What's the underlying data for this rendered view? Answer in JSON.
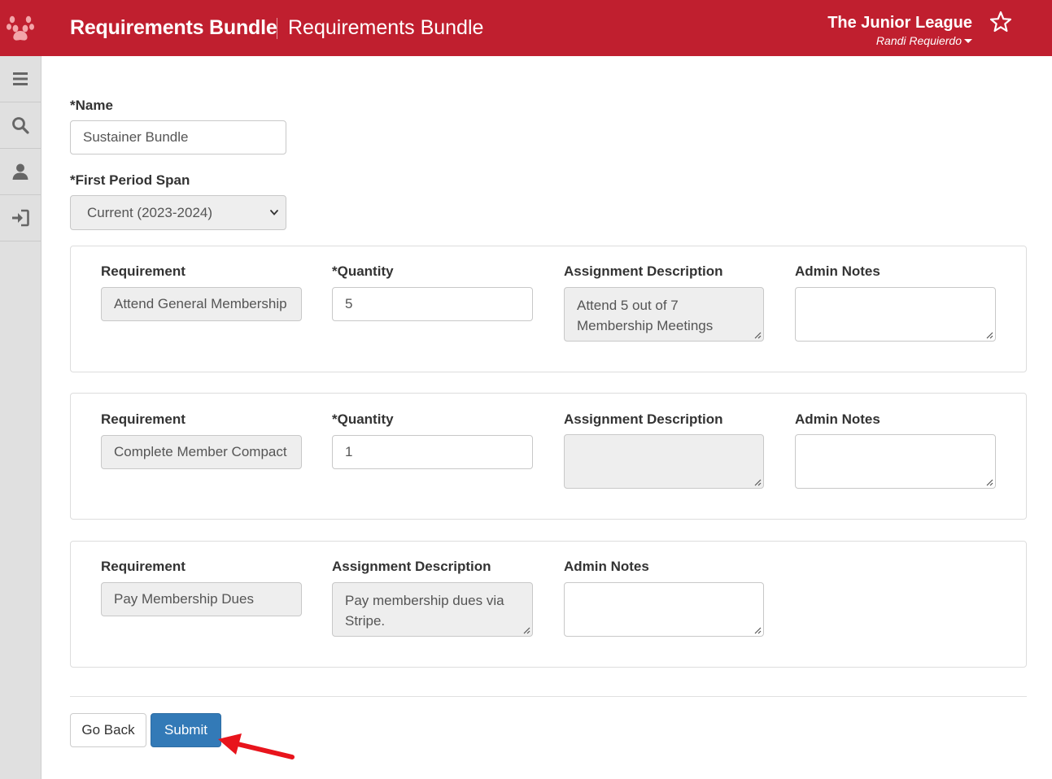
{
  "header": {
    "title": "Requirements Bundle",
    "subtitle": "Requirements Bundle",
    "organization": "The Junior League",
    "user_name": "Randi Requierdo"
  },
  "sidebar": {
    "items": [
      {
        "icon": "menu-icon"
      },
      {
        "icon": "search-icon"
      },
      {
        "icon": "user-icon"
      },
      {
        "icon": "sign-in-icon"
      }
    ]
  },
  "form": {
    "name_label": "*Name",
    "name_value": "Sustainer Bundle",
    "period_label": "*First Period Span",
    "period_value": "Current (2023-2024)"
  },
  "requirements": [
    {
      "requirement_label": "Requirement",
      "requirement_value": "Attend General Membership",
      "quantity_label": "*Quantity",
      "quantity_value": "5",
      "description_label": "Assignment Description",
      "description_value": "Attend 5 out of 7 Membership Meetings",
      "notes_label": "Admin Notes",
      "notes_value": ""
    },
    {
      "requirement_label": "Requirement",
      "requirement_value": "Complete Member Compact",
      "quantity_label": "*Quantity",
      "quantity_value": "1",
      "description_label": "Assignment Description",
      "description_value": "",
      "notes_label": "Admin Notes",
      "notes_value": ""
    },
    {
      "requirement_label": "Requirement",
      "requirement_value": "Pay Membership Dues",
      "description_label": "Assignment Description",
      "description_value": "Pay membership dues via Stripe.",
      "notes_label": "Admin Notes",
      "notes_value": ""
    }
  ],
  "actions": {
    "back_label": "Go Back",
    "submit_label": "Submit"
  },
  "colors": {
    "header_bg": "#c01f2f",
    "primary_button": "#337ab7",
    "annotation_arrow": "#e8141c"
  }
}
